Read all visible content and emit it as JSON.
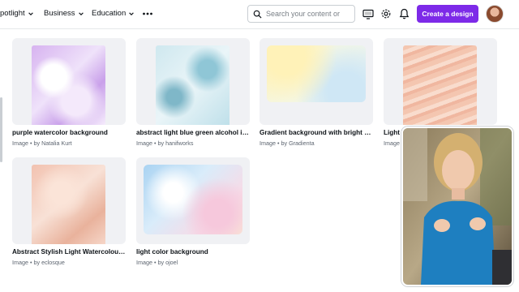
{
  "nav": {
    "items": [
      {
        "label": "potlight"
      },
      {
        "label": "Business"
      },
      {
        "label": "Education"
      }
    ],
    "more_icon": "ellipsis-icon"
  },
  "search": {
    "placeholder": "Search your content or",
    "icon": "search-icon"
  },
  "toolbar": {
    "icons": [
      "monitor-icon",
      "gear-icon",
      "bell-icon"
    ],
    "create_label": "Create a design",
    "create_color": "#7d2ae8"
  },
  "results": [
    {
      "title": "purple watercolor background",
      "meta": "Image • by Natalia Kurt"
    },
    {
      "title": "abstract light blue green alcohol in...",
      "meta": "Image • by hanifworks"
    },
    {
      "title": "Gradient background with bright m...",
      "meta": "Image • by Gradienta"
    },
    {
      "title": "Light V",
      "meta": "Image"
    },
    {
      "title": "Abstract Stylish Light Watercolour ...",
      "meta": "Image • by eclosque"
    },
    {
      "title": "light color background",
      "meta": "Image • by ojoel"
    }
  ]
}
